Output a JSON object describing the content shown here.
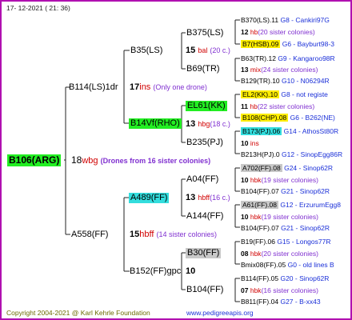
{
  "header": {
    "date": "17- 12-2021 ( 21: 36)"
  },
  "footer": {
    "copyright": "Copyright 2004-2021 @ Karl Kehrle Foundation",
    "website": "www.pedigreeapis.org"
  },
  "colors": {
    "border": "#b010b0",
    "green_highlight": "#22ee22",
    "cyan_highlight": "#33dddd",
    "yellow_highlight": "#ffee00",
    "grey_highlight": "#c8c8c8",
    "line_color": "#222222",
    "note_color": "#8030d0",
    "pedigree_id_color": "#1a2fd8"
  },
  "root": {
    "id": "B106(ARG)",
    "num": "18",
    "code": "wbg",
    "note": "(Drones from 16 sister colonies)"
  },
  "gen1": {
    "upper": {
      "id": "B114(LS)1dr",
      "num": "17",
      "code": "ins",
      "note": "(Only one drone)"
    },
    "lower": {
      "id": "A558(FF)",
      "num": "15",
      "code": "hbff",
      "note": "(14 sister colonies)"
    }
  },
  "gen2": {
    "b35": {
      "id": "B35(LS)",
      "num": "15",
      "code": "bal",
      "note": "(20 c.)"
    },
    "b14": {
      "id": "B14Vf(RHO)",
      "num": "13",
      "code": "hbg",
      "note": "(18 c.)"
    },
    "a489": {
      "id": "A489(FF)",
      "num": "13",
      "code": "hbff",
      "note": "(16 c.)"
    },
    "b152": {
      "id": "B152(FF)gpc",
      "num": "10"
    }
  },
  "gen3": {
    "b375": {
      "id": "B375(LS)"
    },
    "b69": {
      "id": "B69(TR)"
    },
    "el61": {
      "id": "EL61(KK)"
    },
    "b235": {
      "id": "B235(PJ)"
    },
    "a04": {
      "id": "A04(FF)"
    },
    "a144": {
      "id": "A144(FF)"
    },
    "b30": {
      "id": "B30(FF)"
    },
    "b104": {
      "id": "B104(FF)"
    }
  },
  "gen4": [
    {
      "id": "B370(LS).11",
      "ped": "G8 - Cankiri97G"
    },
    {
      "num": "12",
      "code": "hb",
      "note": "(20 sister colonies)"
    },
    {
      "id": "B7(HSB).09",
      "ped": "G6 - Bayburt98-3"
    },
    {
      "id": "B63(TR).12",
      "ped": "G9 - Kangaroo98R"
    },
    {
      "num": "13",
      "code": "mix",
      "note": "(24 sister colonies)"
    },
    {
      "id": "B129(TR).10",
      "ped": "G10 - N06294R"
    },
    {
      "id": "EL2(KK).10",
      "ped": "G8 - not registe"
    },
    {
      "num": "11",
      "code": "hb",
      "note": "(22 sister colonies)"
    },
    {
      "id": "B108(CHP).08",
      "ped": "G6 - B262(NE)"
    },
    {
      "id": "B173(PJ).06",
      "ped": "G14 - AthosSt80R"
    },
    {
      "num": "10",
      "code": "ins",
      "note": ""
    },
    {
      "id": "B213H(PJ).0",
      "ped": "G12 - SinopEgg86R"
    },
    {
      "id": "A702(FF).08",
      "ped": "G24 - Sinop62R"
    },
    {
      "num": "10",
      "code": "hbk",
      "note": "(19 sister colonies)"
    },
    {
      "id": "B104(FF).07",
      "ped": "G21 - Sinop62R"
    },
    {
      "id": "A61(FF).08",
      "ped": "G12 - ErzurumEgg8"
    },
    {
      "num": "10",
      "code": "hbk",
      "note": "(19 sister colonies)"
    },
    {
      "id": "B104(FF).07",
      "ped": "G21 - Sinop62R"
    },
    {
      "id": "B19(FF).06",
      "ped": "G15 - Longos77R"
    },
    {
      "num": "08",
      "code": "hbk",
      "note": "(20 sister colonies)"
    },
    {
      "id": "Bmix08(FF).05",
      "ped": "G0 - old lines B"
    },
    {
      "id": "B114(FF).05",
      "ped": "G20 - Sinop62R"
    },
    {
      "num": "07",
      "code": "hbk",
      "note": "(16 sister colonies)"
    },
    {
      "id": "B811(FF).04",
      "ped": "G27 - B-xx43"
    }
  ]
}
